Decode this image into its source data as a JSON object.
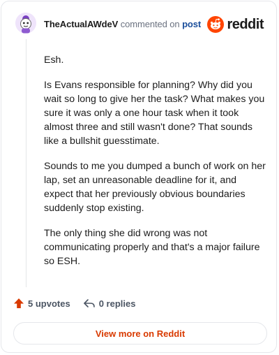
{
  "comment": {
    "author": "TheActualAWdeV",
    "action_text": "commented on",
    "post_link": "post",
    "paragraphs": [
      "Esh.",
      "Is Evans responsible for planning? Why did you wait so long to give her the task? What makes you sure it was only a one hour task when it took almost three and still wasn't done? That sounds like a bullshit guesstimate.",
      "Sounds to me you dumped a bunch of work on her lap, set an unreasonable deadline for it, and expect that her previously obvious boundaries suddenly stop existing.",
      "The only thing she did wrong was not communicating properly and that's a major failure so ESH."
    ],
    "upvotes_label": "5 upvotes",
    "replies_label": "0 replies"
  },
  "brand": {
    "wordmark": "reddit",
    "icon": "reddit-snoo-icon"
  },
  "view_more_label": "View more on Reddit",
  "colors": {
    "brand_orange": "#ff4500",
    "upvote": "#d93a00",
    "link_blue": "#1c4f9c"
  }
}
